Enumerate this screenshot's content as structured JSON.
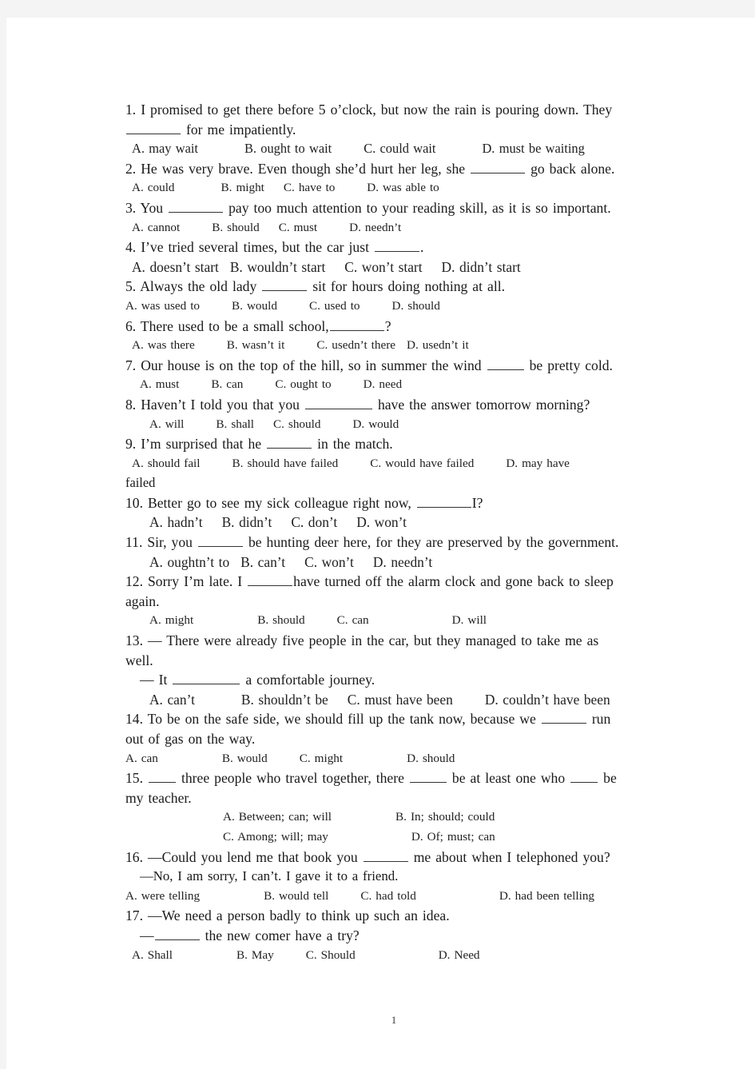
{
  "document": {
    "page_number": "1",
    "questions": [
      {
        "id": "q1",
        "stem_lines": [
          "1. I promised to get there before 5 o’clock, but now the rain is pouring down. They",
          "for me impatiently."
        ],
        "options": [
          "A. may wait",
          "B. ought to wait",
          "C. could wait",
          "D. must be waiting"
        ]
      },
      {
        "id": "q2",
        "stem_lines": [
          "2. He was very brave. Even though she’d hurt her leg, she",
          "go back alone."
        ],
        "options": [
          "A. could",
          "B. might",
          "C. have to",
          "D. was able to"
        ]
      },
      {
        "id": "q3",
        "stem_lines": [
          "3. You",
          "pay too much attention to your reading skill, as it is so important."
        ],
        "options": [
          "A. cannot",
          "B. should",
          "C. must",
          "D. needn’t"
        ]
      },
      {
        "id": "q4",
        "stem_lines": [
          "4. I’ve tried several times, but the car just",
          "."
        ],
        "options": [
          "A. doesn’t start",
          "B. wouldn’t start",
          "C. won’t start",
          "D. didn’t start"
        ]
      },
      {
        "id": "q5",
        "stem_lines": [
          "5. Always the old lady",
          "sit for hours doing nothing at all."
        ],
        "options": [
          "A. was used to",
          "B. would",
          "C. used to",
          "D. should"
        ]
      },
      {
        "id": "q6",
        "stem_lines": [
          "6. There used to be a small school,",
          "?"
        ],
        "options": [
          "A. was there",
          "B. wasn’t it",
          "C. usedn’t there",
          "D. usedn’t it"
        ]
      },
      {
        "id": "q7",
        "stem_lines": [
          "7. Our house is on the top of the hill, so in summer the wind",
          "be pretty cold."
        ],
        "options": [
          "A. must",
          "B. can",
          "C. ought to",
          "D. need"
        ]
      },
      {
        "id": "q8",
        "stem_lines": [
          "8. Haven’t I told you that you",
          "have the answer tomorrow morning?"
        ],
        "options": [
          "A. will",
          "B. shall",
          "C. should",
          "D. would"
        ]
      },
      {
        "id": "q9",
        "stem_lines": [
          "9. I’m surprised that he",
          "in the match."
        ],
        "options": [
          "A. should fail",
          "B. should have failed",
          "C. would have failed",
          "D. may have"
        ],
        "options_wrap": "failed"
      },
      {
        "id": "q10",
        "stem_lines": [
          "10. Better go to see my sick colleague right now,",
          "I?"
        ],
        "options": [
          "A. hadn’t",
          "B. didn’t",
          "C. don’t",
          "D. won’t"
        ]
      },
      {
        "id": "q11",
        "stem_lines": [
          "11. Sir, you",
          "be hunting deer here, for they are preserved by the government."
        ],
        "options": [
          "A. oughtn’t to",
          "B. can’t",
          "C. won’t",
          "D. needn’t"
        ]
      },
      {
        "id": "q12",
        "stem_lines": [
          "12. Sorry I’m late. I",
          "have turned off the alarm clock and gone back to sleep"
        ],
        "stem_wrap": "again.",
        "options": [
          "A. might",
          "B. should",
          "C. can",
          "D. will"
        ]
      },
      {
        "id": "q13",
        "stem_lines": [
          "13. — There were already five people in the car, but they managed to take me as"
        ],
        "stem_wrap": "well.",
        "stem_second": [
          "— It",
          "a comfortable journey."
        ],
        "options": [
          "A. can’t",
          "B. shouldn’t be",
          "C. must have been",
          "D. couldn’t have been"
        ]
      },
      {
        "id": "q14",
        "stem_lines": [
          "14. To be on the safe side, we should fill up the tank now, because we",
          "run"
        ],
        "stem_wrap": "out of gas on the way.",
        "options": [
          "A. can",
          "B. would",
          "C. might",
          "D. should"
        ]
      },
      {
        "id": "q15",
        "stem_lines": [
          "15.",
          "three people who travel together, there",
          "be at least one who",
          "be"
        ],
        "stem_wrap": "my teacher.",
        "options_grid": [
          [
            "A. Between; can; will",
            "B. In; should; could"
          ],
          [
            "C. Among; will; may",
            "D. Of; must; can"
          ]
        ]
      },
      {
        "id": "q16",
        "stem_lines": [
          "16. —Could you lend me that book you",
          "me about when I telephoned you?"
        ],
        "stem_second_single": "—No, I am sorry, I can’t. I gave it to a friend.",
        "options": [
          "A. were telling",
          "B. would tell",
          "C. had told",
          "D. had been telling"
        ]
      },
      {
        "id": "q17",
        "stem_lines": [
          "17. —We need a person badly to think up such an idea."
        ],
        "stem_second": [
          "—",
          "the new comer have a try?"
        ],
        "options": [
          "A. Shall",
          "B. May",
          "C. Should",
          "D. Need"
        ]
      }
    ]
  }
}
